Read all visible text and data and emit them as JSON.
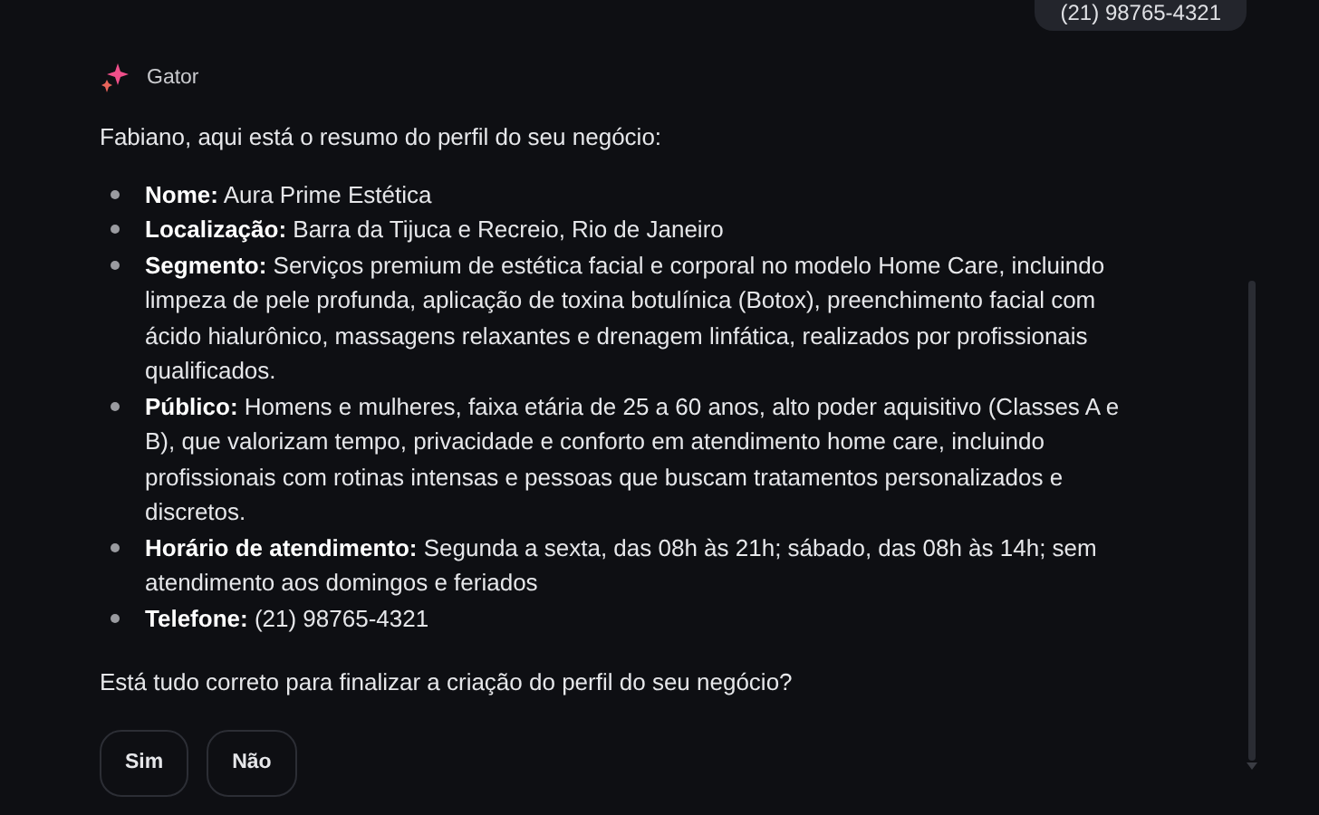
{
  "user_message": {
    "text": "(21) 98765-4321"
  },
  "assistant": {
    "name": "Gator",
    "intro": "Fabiano, aqui está o resumo do perfil do seu negócio:",
    "items": [
      {
        "text": "**Nome:** Aura Prime Estética"
      },
      {
        "text": "**Localização:** Barra da Tijuca e Recreio, Rio de Janeiro"
      },
      {
        "text": "**Segmento:** Serviços premium de estética facial e corporal no modelo Home Care, incluindo limpeza de pele profunda, aplicação de toxina botulínica (Botox), preenchimento facial com ácido hialurônico, massagens relaxantes e drenagem linfática, realizados por profissionais qualificados."
      },
      {
        "text": "**Público:** Homens e mulheres, faixa etária de 25 a 60 anos, alto poder aquisitivo (Classes A e B), que valorizam tempo, privacidade e conforto em atendimento home care, incluindo profissionais com rotinas intensas e pessoas que buscam tratamentos personalizados e discretos."
      },
      {
        "text": "**Horário de atendimento:** Segunda a sexta, das 08h às 21h; sábado, das 08h às 14h; sem atendimento aos domingos e feriados"
      },
      {
        "text": "**Telefone:** (21) 98765-4321"
      }
    ],
    "question": "Está tudo correto para finalizar a criação do perfil do seu negócio?",
    "buttons": [
      "Sim",
      "Não"
    ]
  }
}
